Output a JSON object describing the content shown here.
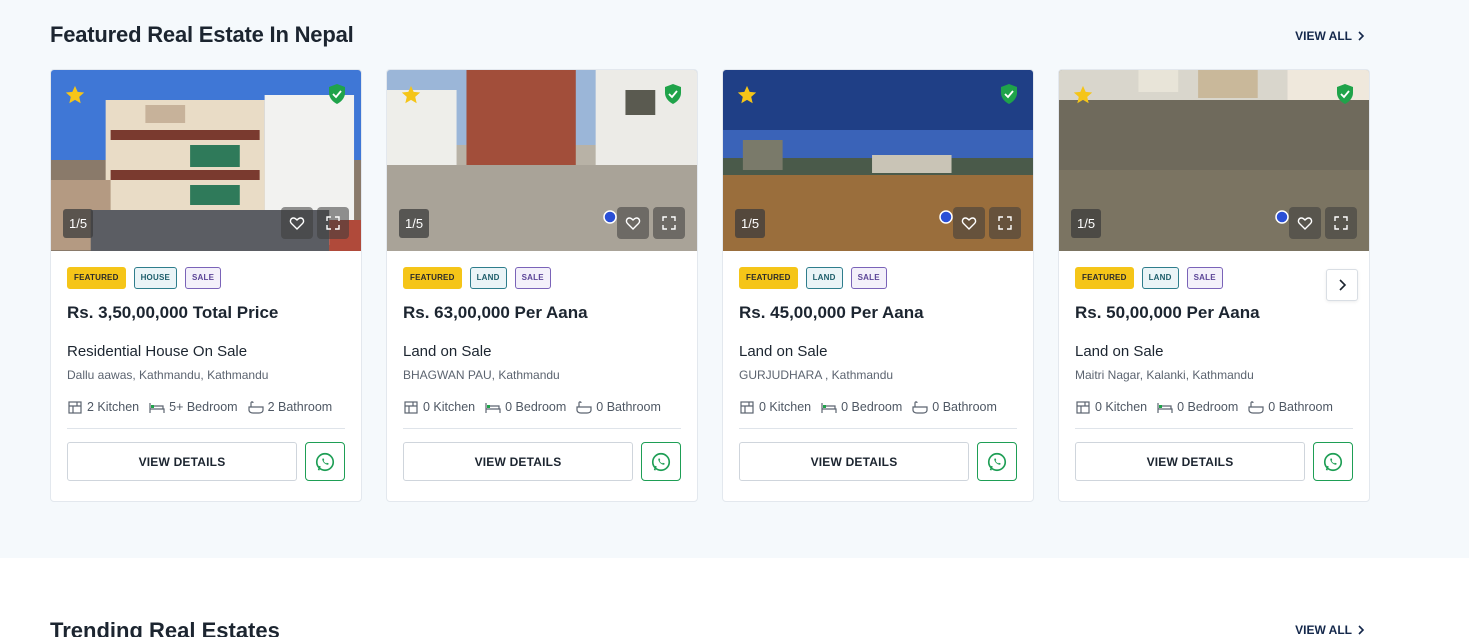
{
  "featured": {
    "title": "Featured Real Estate In Nepal",
    "view_all": "VIEW ALL"
  },
  "trending": {
    "title": "Trending Real Estates",
    "view_all": "VIEW ALL"
  },
  "colors": {
    "featured_tag": "#f5c518",
    "verified_shield": "#1fa34a",
    "whatsapp": "#1e9e55"
  },
  "cards": [
    {
      "image_counter": "1/5",
      "tags": [
        "FEATURED",
        "HOUSE",
        "SALE"
      ],
      "price": "Rs. 3,50,00,000 Total Price",
      "title": "Residential House On Sale",
      "location": "Dallu aawas, Kathmandu, Kathmandu",
      "kitchen": "2 Kitchen",
      "bedroom": "5+ Bedroom",
      "bathroom": "2 Bathroom",
      "button": "VIEW DETAILS"
    },
    {
      "image_counter": "1/5",
      "tags": [
        "FEATURED",
        "LAND",
        "SALE"
      ],
      "price": "Rs. 63,00,000 Per Aana",
      "title": "Land on Sale",
      "location": "BHAGWAN PAU, Kathmandu",
      "kitchen": "0 Kitchen",
      "bedroom": "0 Bedroom",
      "bathroom": "0 Bathroom",
      "button": "VIEW DETAILS"
    },
    {
      "image_counter": "1/5",
      "tags": [
        "FEATURED",
        "LAND",
        "SALE"
      ],
      "price": "Rs. 45,00,000 Per Aana",
      "title": "Land on Sale",
      "location": "GURJUDHARA , Kathmandu",
      "kitchen": "0 Kitchen",
      "bedroom": "0 Bedroom",
      "bathroom": "0 Bathroom",
      "button": "VIEW DETAILS"
    },
    {
      "image_counter": "1/5",
      "tags": [
        "FEATURED",
        "LAND",
        "SALE"
      ],
      "price": "Rs. 50,00,000 Per Aana",
      "title": "Land on Sale",
      "location": "Maitri Nagar, Kalanki, Kathmandu",
      "kitchen": "0 Kitchen",
      "bedroom": "0 Bedroom",
      "bathroom": "0 Bathroom",
      "button": "VIEW DETAILS"
    }
  ],
  "icons": {
    "featured_star": "star-icon",
    "verified": "shield-check-icon",
    "favorite": "heart-icon",
    "fullscreen": "fullscreen-icon",
    "kitchen": "kitchen-icon",
    "bedroom": "bed-icon",
    "bathroom": "bathtub-icon",
    "contact": "whatsapp-icon",
    "carousel_next": "chevron-right-icon"
  }
}
